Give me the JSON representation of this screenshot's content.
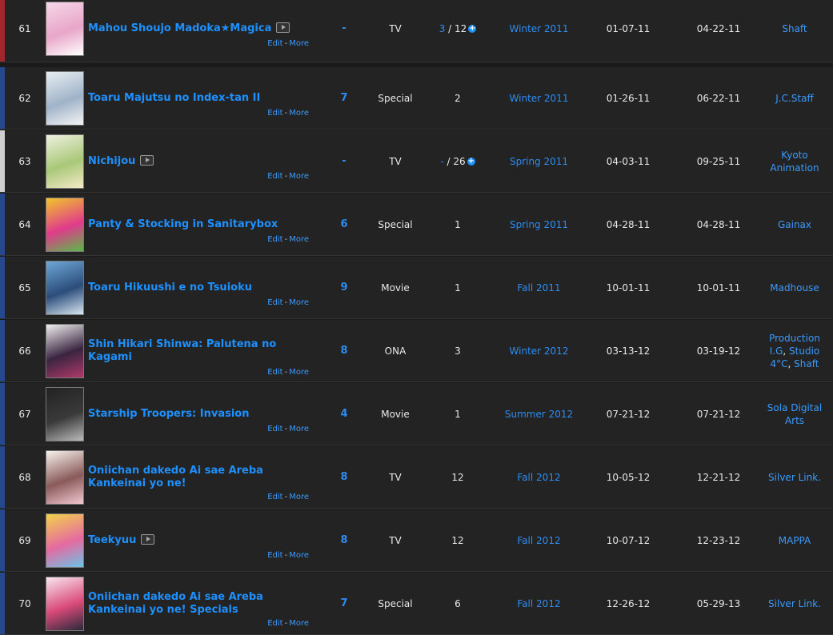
{
  "rows": [
    {
      "num": "61",
      "title": "Mahou Shoujo Madoka★Magica",
      "score": "-",
      "type": "TV",
      "eps_watched": "3",
      "eps_total": "12",
      "eps_plus": true,
      "season": "Winter 2011",
      "start": "01-07-11",
      "end": "04-22-11",
      "studios": [
        "Shaft"
      ],
      "bar": "#a3252d",
      "tv": true,
      "thumb": [
        "#f6d7e8",
        "#e8a6c8",
        "#ffffff"
      ]
    },
    {
      "num": "62",
      "title": "Toaru Majutsu no Index-tan II",
      "score": "7",
      "type": "Special",
      "eps_watched": "",
      "eps_total": "2",
      "eps_plus": false,
      "season": "Winter 2011",
      "start": "01-26-11",
      "end": "06-22-11",
      "studios": [
        "J.C.Staff"
      ],
      "bar": "#26488f",
      "tv": false,
      "thumb": [
        "#e8eef2",
        "#9fb3c8",
        "#f5f5f5"
      ]
    },
    {
      "num": "63",
      "title": "Nichijou",
      "score": "-",
      "type": "TV",
      "eps_watched": "-",
      "eps_total": "26",
      "eps_plus": true,
      "season": "Spring 2011",
      "start": "04-03-11",
      "end": "09-25-11",
      "studios": [
        "Kyoto Animation"
      ],
      "bar": "#cfcfcf",
      "tv": true,
      "thumb": [
        "#eef0e0",
        "#a9c878",
        "#f4e9c8"
      ]
    },
    {
      "num": "64",
      "title": "Panty & Stocking in Sanitarybox",
      "score": "6",
      "type": "Special",
      "eps_watched": "",
      "eps_total": "1",
      "eps_plus": false,
      "season": "Spring 2011",
      "start": "04-28-11",
      "end": "04-28-11",
      "studios": [
        "Gainax"
      ],
      "bar": "#26488f",
      "tv": false,
      "thumb": [
        "#f2c62b",
        "#e03b8b",
        "#58b947"
      ]
    },
    {
      "num": "65",
      "title": "Toaru Hikuushi e no Tsuioku",
      "score": "9",
      "type": "Movie",
      "eps_watched": "",
      "eps_total": "1",
      "eps_plus": false,
      "season": "Fall 2011",
      "start": "10-01-11",
      "end": "10-01-11",
      "studios": [
        "Madhouse"
      ],
      "bar": "#26488f",
      "tv": false,
      "thumb": [
        "#6fa7d8",
        "#2b4d7a",
        "#d9e6f2"
      ]
    },
    {
      "num": "66",
      "title": "Shin Hikari Shinwa: Palutena no Kagami",
      "score": "8",
      "type": "ONA",
      "eps_watched": "",
      "eps_total": "3",
      "eps_plus": false,
      "season": "Winter 2012",
      "start": "03-13-12",
      "end": "03-19-12",
      "studios": [
        "Production I.G",
        "Studio 4°C",
        "Shaft"
      ],
      "bar": "#26488f",
      "tv": false,
      "thumb": [
        "#f0f0f0",
        "#3a2440",
        "#b03a6a"
      ]
    },
    {
      "num": "67",
      "title": "Starship Troopers: Invasion",
      "score": "4",
      "type": "Movie",
      "eps_watched": "",
      "eps_total": "1",
      "eps_plus": false,
      "season": "Summer 2012",
      "start": "07-21-12",
      "end": "07-21-12",
      "studios": [
        "Sola Digital Arts"
      ],
      "bar": "#26488f",
      "tv": false,
      "thumb": [
        "#222222",
        "#3a3a3a",
        "#bbbbbb"
      ]
    },
    {
      "num": "68",
      "title": "Oniichan dakedo Ai sae Areba Kankeinai yo ne!",
      "score": "8",
      "type": "TV",
      "eps_watched": "",
      "eps_total": "12",
      "eps_plus": false,
      "season": "Fall 2012",
      "start": "10-05-12",
      "end": "12-21-12",
      "studios": [
        "Silver Link."
      ],
      "bar": "#26488f",
      "tv": false,
      "thumb": [
        "#f7f3ee",
        "#8a5a5a",
        "#f2c9d2"
      ]
    },
    {
      "num": "69",
      "title": "Teekyuu",
      "score": "8",
      "type": "TV",
      "eps_watched": "",
      "eps_total": "12",
      "eps_plus": false,
      "season": "Fall 2012",
      "start": "10-07-12",
      "end": "12-23-12",
      "studios": [
        "MAPPA"
      ],
      "bar": "#26488f",
      "tv": true,
      "thumb": [
        "#f3d34a",
        "#e56aa0",
        "#6dc3e8"
      ]
    },
    {
      "num": "70",
      "title": "Oniichan dakedo Ai sae Areba Kankeinai yo ne! Specials",
      "score": "7",
      "type": "Special",
      "eps_watched": "",
      "eps_total": "6",
      "eps_plus": false,
      "season": "Fall 2012",
      "start": "12-26-12",
      "end": "05-29-13",
      "studios": [
        "Silver Link."
      ],
      "bar": "#26488f",
      "tv": false,
      "thumb": [
        "#f9e6ee",
        "#d94a7a",
        "#2a2a3a"
      ]
    }
  ],
  "labels": {
    "edit": "Edit",
    "more": "More",
    "sep": "-",
    "eps_sep": "/"
  }
}
